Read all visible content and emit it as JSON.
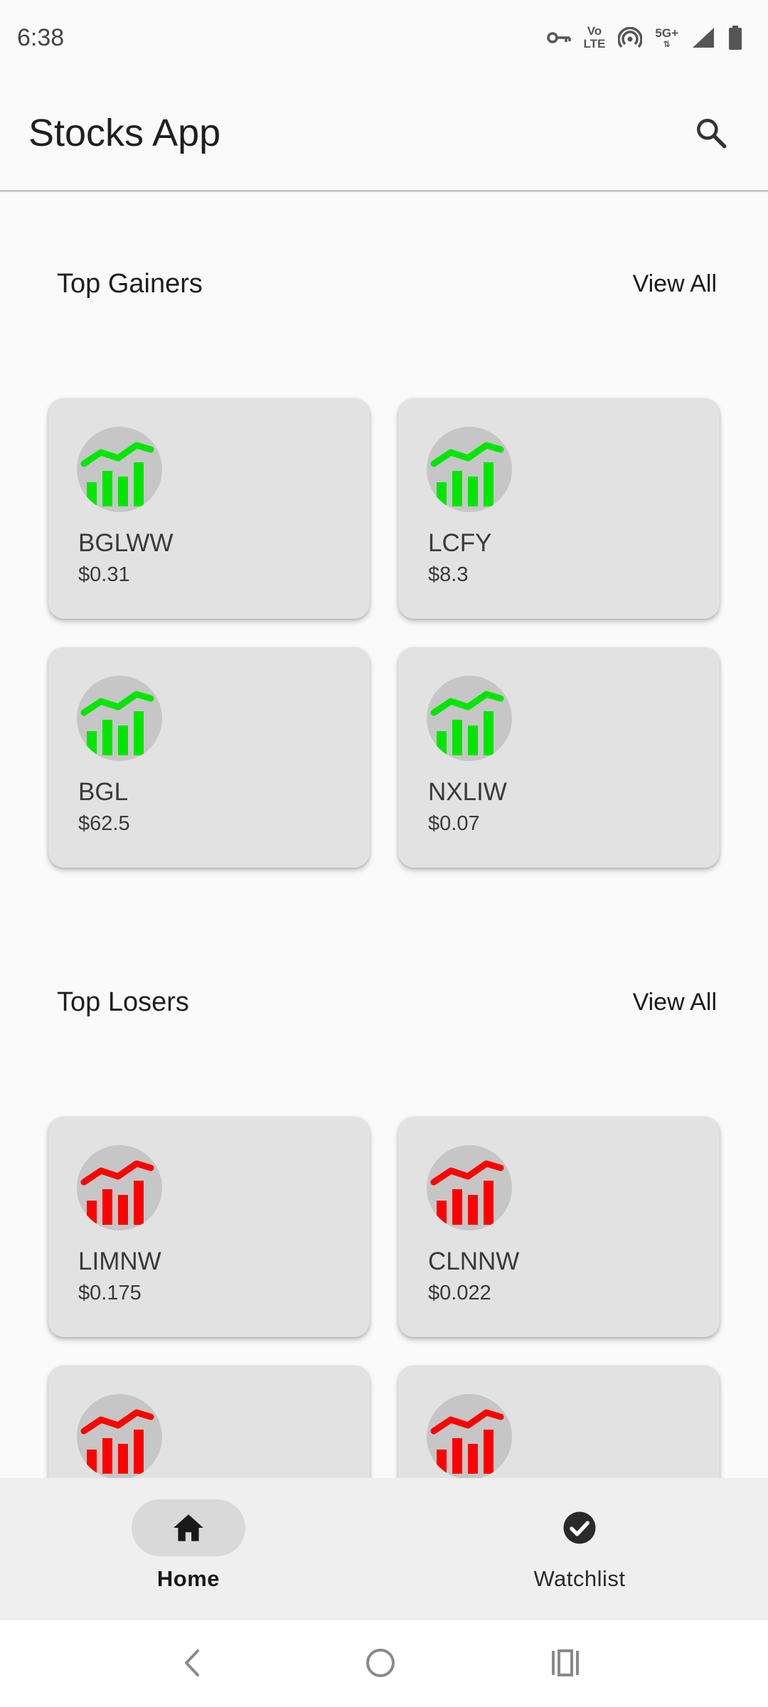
{
  "status_bar": {
    "time": "6:38",
    "volte_top": "Vo",
    "volte_bottom": "LTE",
    "network": "5G+",
    "icons": [
      "vpn-key-icon",
      "volte-icon",
      "hotspot-icon",
      "5g-icon",
      "signal-icon",
      "battery-icon"
    ]
  },
  "app_bar": {
    "title": "Stocks App",
    "search_icon": "search-icon"
  },
  "sections": {
    "gainers": {
      "title": "Top Gainers",
      "view_all": "View All",
      "color": "#00e600",
      "items": [
        {
          "symbol": "BGLWW",
          "price": "$0.31"
        },
        {
          "symbol": "LCFY",
          "price": "$8.3"
        },
        {
          "symbol": "BGL",
          "price": "$62.5"
        },
        {
          "symbol": "NXLIW",
          "price": "$0.07"
        }
      ]
    },
    "losers": {
      "title": "Top Losers",
      "view_all": "View All",
      "color": "#ff0000",
      "items": [
        {
          "symbol": "LIMNW",
          "price": "$0.175"
        },
        {
          "symbol": "CLNNW",
          "price": "$0.022"
        }
      ]
    }
  },
  "bottom_nav": {
    "items": [
      {
        "label": "Home",
        "icon": "home-icon",
        "active": true
      },
      {
        "label": "Watchlist",
        "icon": "check-circle-icon",
        "active": false
      }
    ]
  },
  "system_nav": {
    "icons": [
      "back-icon",
      "home-circle-icon",
      "recents-icon"
    ]
  }
}
